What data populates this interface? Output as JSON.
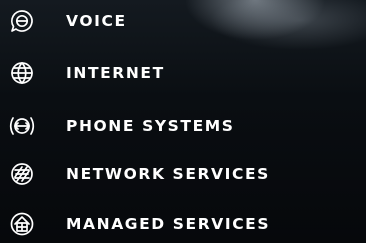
{
  "menu": {
    "items": [
      {
        "label": "VOICE",
        "icon": "chat-bubble-icon"
      },
      {
        "label": "INTERNET",
        "icon": "globe-icon"
      },
      {
        "label": "PHONE SYSTEMS",
        "icon": "phone-signal-icon"
      },
      {
        "label": "NETWORK SERVICES",
        "icon": "network-globe-icon"
      },
      {
        "label": "MANAGED SERVICES",
        "icon": "building-gear-icon"
      }
    ]
  },
  "colors": {
    "text": "#ffffff",
    "background": "#070a0e"
  }
}
